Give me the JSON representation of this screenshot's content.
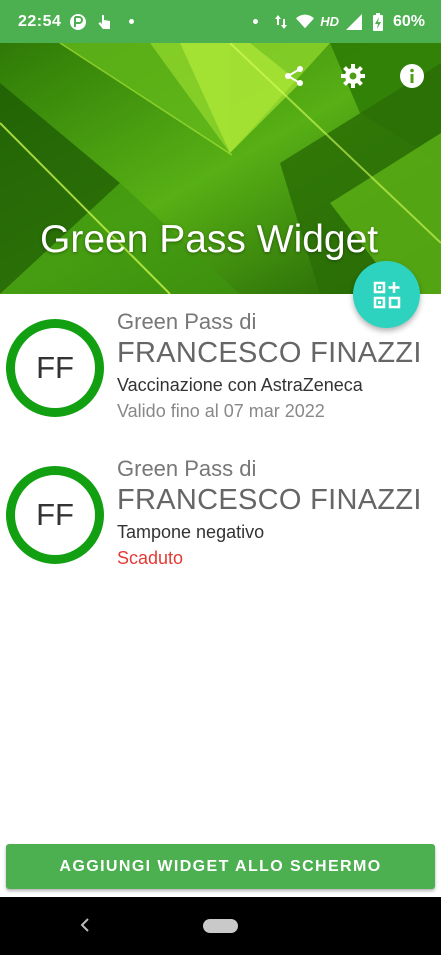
{
  "status_bar": {
    "time": "22:54",
    "network_label": "HD",
    "battery": "60%",
    "icons": [
      "app-notification-icon",
      "touch-icon",
      "dot-icon",
      "dot-icon",
      "data-arrows-icon",
      "wifi-icon",
      "signal-icon",
      "battery-charging-icon"
    ]
  },
  "header": {
    "title": "Green Pass Widget",
    "actions": [
      "share-icon",
      "settings-icon",
      "info-icon"
    ]
  },
  "fab": {
    "icon": "qr-add-icon"
  },
  "passes": [
    {
      "initials": "FF",
      "label": "Green Pass di",
      "name": "FRANCESCO FINAZZI",
      "type": "Vaccinazione con AstraZeneca",
      "status": "Valido fino al 07 mar 2022",
      "status_color": "#888888"
    },
    {
      "initials": "FF",
      "label": "Green Pass di",
      "name": "FRANCESCO FINAZZI",
      "type": "Tampone negativo",
      "status": "Scaduto",
      "status_color": "#e53935"
    }
  ],
  "add_widget_button": "AGGIUNGI WIDGET ALLO SCHERMO",
  "colors": {
    "primary": "#4caf50",
    "avatar_ring": "#12a012",
    "fab": "#2ed3bf",
    "expired": "#e53935"
  }
}
